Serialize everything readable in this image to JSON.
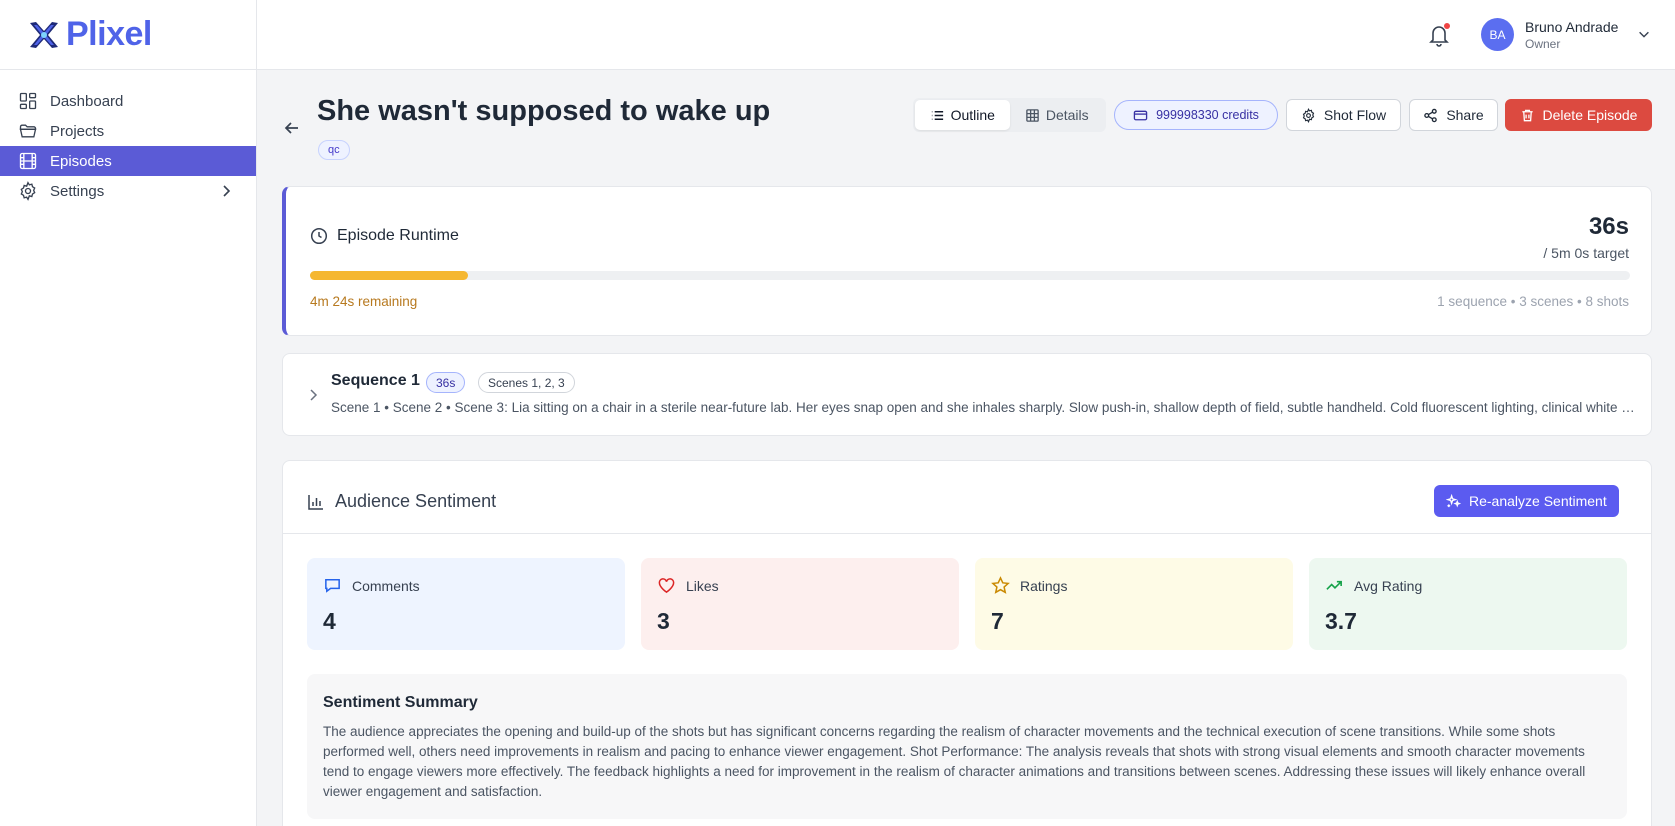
{
  "app": {
    "name": "Plixel"
  },
  "sidebar": {
    "items": [
      {
        "label": "Dashboard",
        "icon": "grid-icon"
      },
      {
        "label": "Projects",
        "icon": "folder-icon"
      },
      {
        "label": "Episodes",
        "icon": "film-icon",
        "active": true
      },
      {
        "label": "Settings",
        "icon": "gear-icon"
      }
    ]
  },
  "header": {
    "user": {
      "initials": "BA",
      "name": "Bruno Andrade",
      "role": "Owner"
    },
    "has_notifications": true
  },
  "episode": {
    "title": "She wasn't supposed to wake up",
    "tag": "qc"
  },
  "toolbar": {
    "view_tabs": [
      {
        "label": "Outline",
        "icon": "list-icon",
        "active": true
      },
      {
        "label": "Details",
        "icon": "table-icon",
        "active": false
      }
    ],
    "credits": "999998330 credits",
    "shot_flow_label": "Shot Flow",
    "share_label": "Share",
    "delete_label": "Delete Episode"
  },
  "runtime": {
    "heading": "Episode Runtime",
    "value": "36s",
    "target": "/ 5m 0s target",
    "progress_percent": 12,
    "remaining": "4m 24s remaining",
    "counts": "1 sequence • 3 scenes • 8 shots"
  },
  "sequence": {
    "title": "Sequence 1",
    "duration": "36s",
    "scenes": "Scenes 1, 2, 3",
    "description": "Scene 1 • Scene 2 • Scene 3: Lia sitting on a chair in a sterile near-future lab. Her eyes snap open and she inhales sharply. Slow push-in, shallow depth of field, subtle handheld. Cold fluorescent lighting, clinical white walls, soft ambient hum."
  },
  "sentiment": {
    "heading": "Audience Sentiment",
    "reanalyze_label": "Re-analyze Sentiment",
    "stats": [
      {
        "label": "Comments",
        "value": "4",
        "icon": "comment-icon",
        "color": "#2563eb"
      },
      {
        "label": "Likes",
        "value": "3",
        "icon": "heart-icon",
        "color": "#dc2626"
      },
      {
        "label": "Ratings",
        "value": "7",
        "icon": "star-icon",
        "color": "#ca8a04"
      },
      {
        "label": "Avg Rating",
        "value": "3.7",
        "icon": "trending-up-icon",
        "color": "#16a34a"
      }
    ],
    "summary_title": "Sentiment Summary",
    "summary_text": "The audience appreciates the opening and build-up of the shots but has significant concerns regarding the realism of character movements and the technical execution of scene transitions. While some shots performed well, others need improvements in realism and pacing to enhance viewer engagement. Shot Performance: The analysis reveals that shots with strong visual elements and smooth character movements tend to engage viewers more effectively. The feedback highlights a need for improvement in the realism of character animations and transitions between scenes. Addressing these issues will likely enhance overall viewer engagement and satisfaction."
  },
  "colors": {
    "accent": "#5b5bd6",
    "brand": "#4f63e8",
    "danger": "#dc4a40",
    "progress": "#f5b731"
  }
}
